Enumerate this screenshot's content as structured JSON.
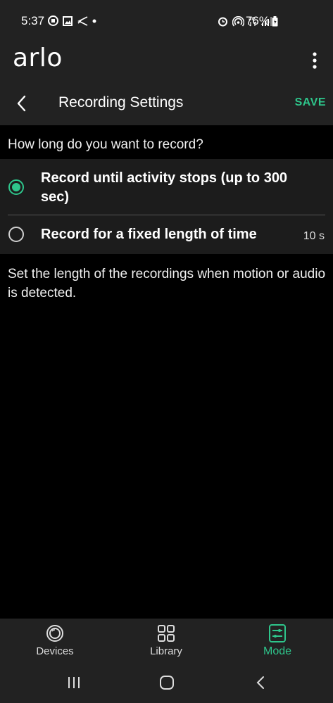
{
  "status_bar": {
    "time": "5:37",
    "battery": "76%",
    "icons_left": [
      "notification-app-icon",
      "gallery-icon",
      "feather-icon",
      "dot-icon"
    ],
    "icons_right": [
      "alarm-icon",
      "hotspot-icon",
      "data-icon",
      "signal-icon",
      "battery-icon"
    ]
  },
  "app_bar": {
    "logo": "arlo",
    "menu_icon": "kebab-menu-icon"
  },
  "title_bar": {
    "title": "Recording Settings",
    "save_label": "SAVE",
    "back_icon": "chevron-left-icon"
  },
  "question": "How long do you want to record?",
  "options": [
    {
      "label": "Record until activity stops (up to 300 sec)",
      "selected": true,
      "value": ""
    },
    {
      "label": "Record for a fixed length of time",
      "selected": false,
      "value": "10 s"
    }
  ],
  "helper_text": "Set the length of the recordings when motion or audio is detected.",
  "bottom_nav": {
    "tabs": [
      {
        "label": "Devices",
        "icon": "devices-icon",
        "active": false
      },
      {
        "label": "Library",
        "icon": "grid-icon",
        "active": false
      },
      {
        "label": "Mode",
        "icon": "mode-icon",
        "active": true
      }
    ]
  },
  "colors": {
    "accent": "#2ec58b",
    "bar_background": "#222222",
    "page_background": "#000000",
    "options_background": "#1c1c1c"
  },
  "system_nav": [
    "recents-icon",
    "home-icon",
    "back-icon"
  ]
}
